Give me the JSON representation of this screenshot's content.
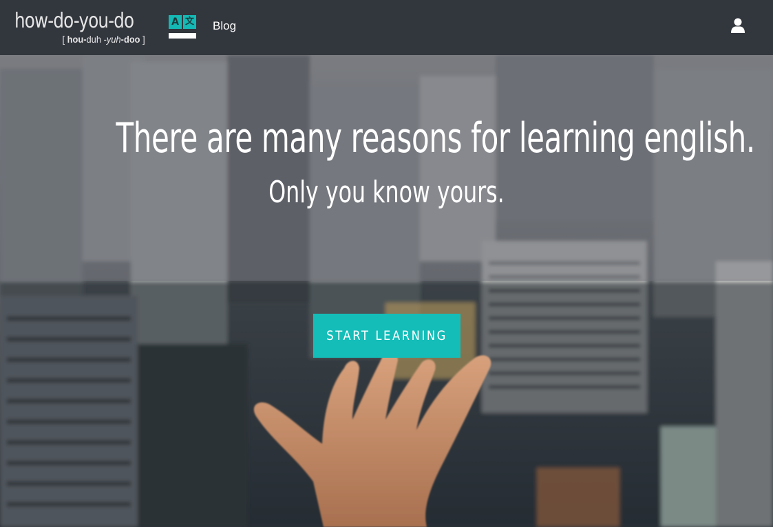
{
  "brand": {
    "title": "how-do-you-do",
    "pronunciation": {
      "open": "[",
      "part1": "hou-",
      "part2": "duh",
      "dash": " -",
      "part3": "yuh",
      "part4": "-doo",
      "close": "]"
    }
  },
  "language_icon": {
    "left_glyph": "A",
    "right_glyph": "文"
  },
  "nav": {
    "blog_label": "Blog"
  },
  "hero": {
    "headline": "There are many reasons for learning english.",
    "subheadline": "Only you know yours.",
    "cta_label": "START LEARNING"
  },
  "colors": {
    "navbar": "#32363d",
    "accent": "#14bdb8",
    "text": "#ffffff"
  },
  "icons": [
    "translate-icon",
    "user-icon"
  ]
}
